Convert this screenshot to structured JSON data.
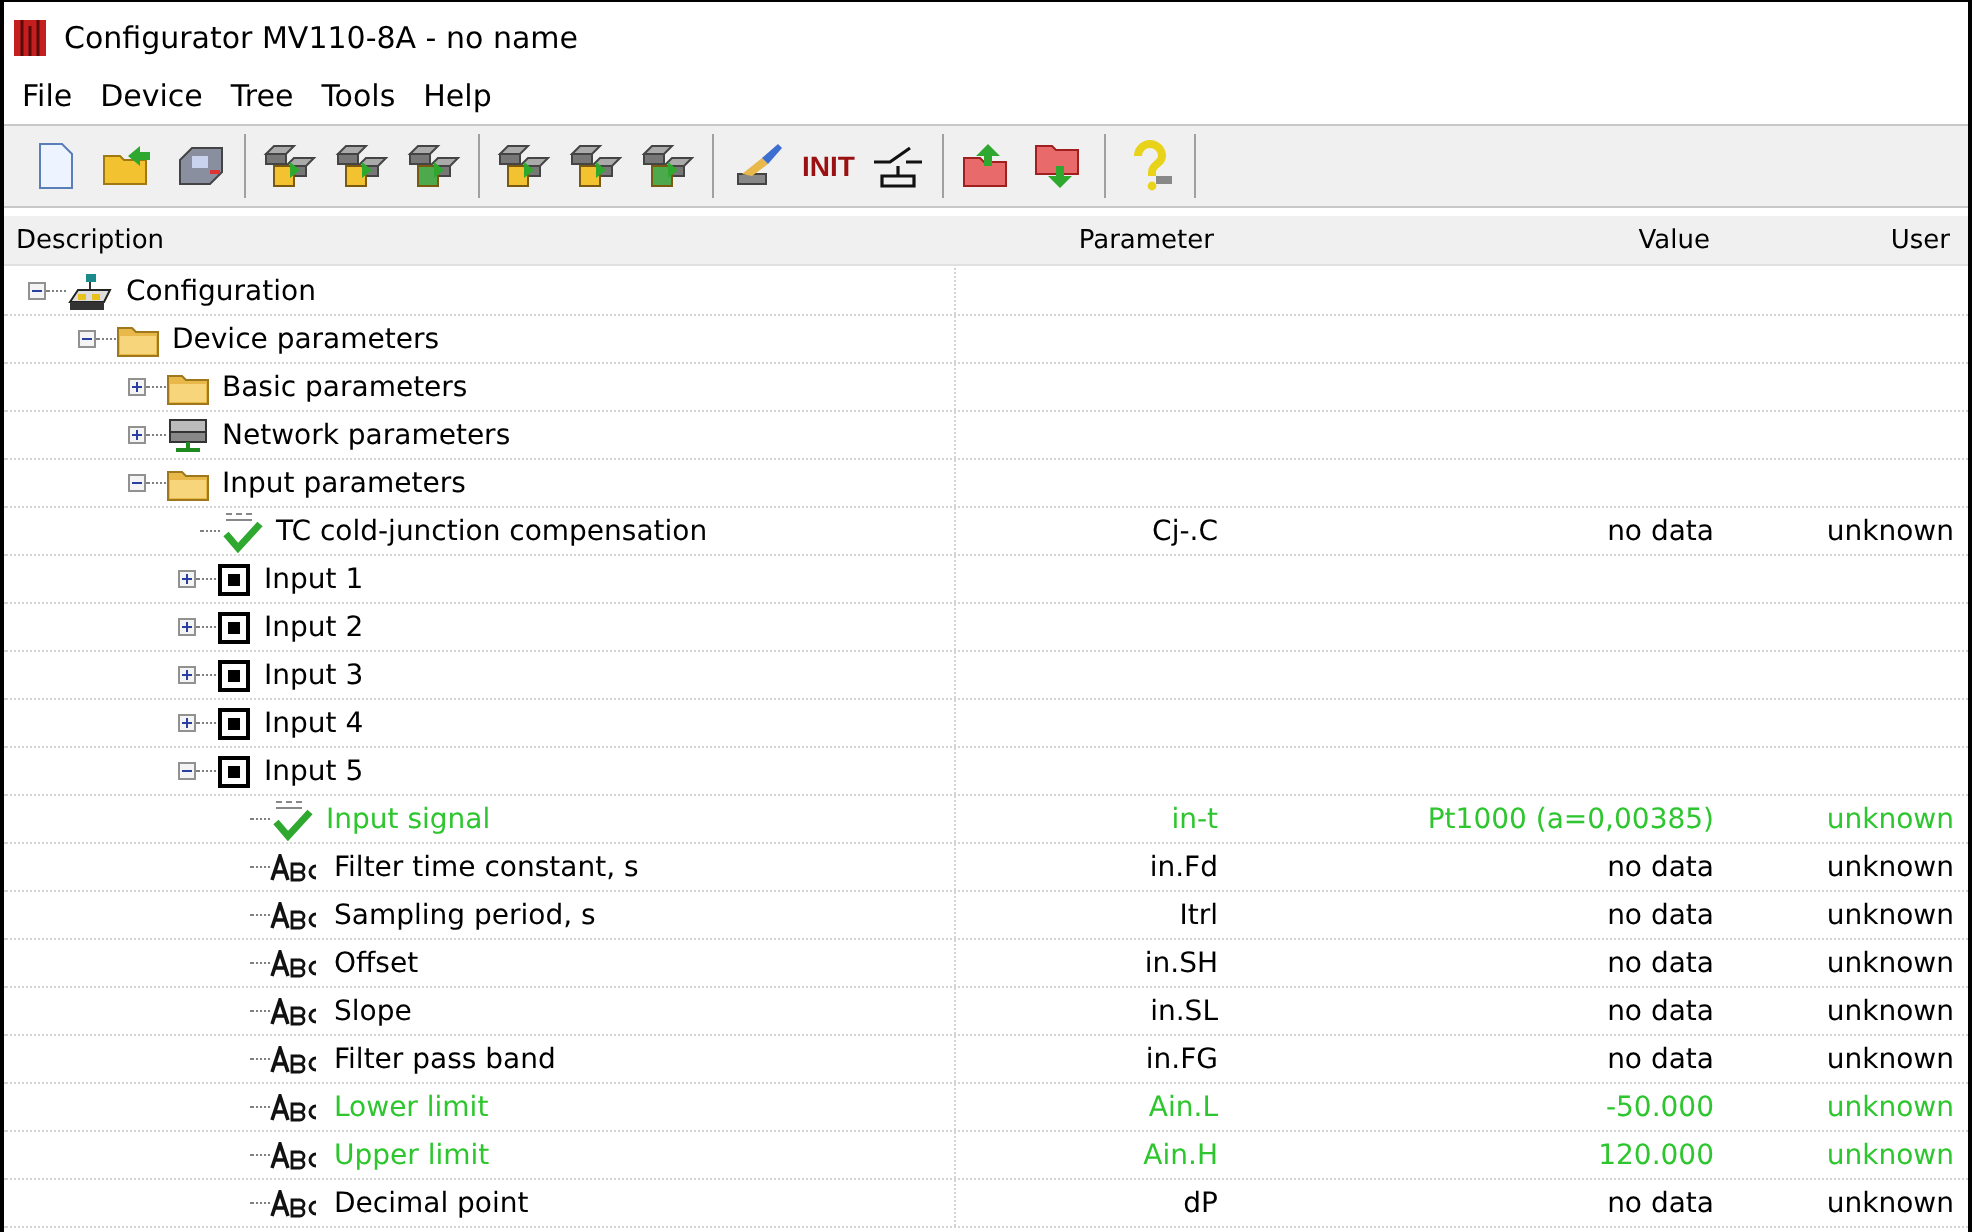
{
  "window": {
    "title": "Configurator MV110-8A - no name"
  },
  "menu": [
    {
      "label": "File"
    },
    {
      "label": "Device"
    },
    {
      "label": "Tree"
    },
    {
      "label": "Tools"
    },
    {
      "label": "Help"
    }
  ],
  "toolbar": [
    [
      {
        "kind": "icon"
      },
      {
        "kind": "icon"
      },
      {
        "kind": "icon"
      }
    ],
    [
      {
        "kind": "icon"
      },
      {
        "kind": "icon"
      },
      {
        "kind": "icon"
      }
    ],
    [
      {
        "kind": "icon"
      },
      {
        "kind": "icon"
      },
      {
        "kind": "icon"
      }
    ],
    [
      {
        "kind": "icon"
      },
      {
        "kind": "text",
        "label": "INIT"
      },
      {
        "kind": "icon"
      }
    ],
    [
      {
        "kind": "icon"
      },
      {
        "kind": "icon"
      }
    ],
    [
      {
        "kind": "icon"
      }
    ]
  ],
  "columns": [
    "Description",
    "Parameter",
    "Value",
    "User"
  ],
  "tree": [
    {
      "label": "Configuration",
      "kind": "config",
      "expanded": true,
      "children": [
        {
          "label": "Device parameters",
          "kind": "folder",
          "expanded": true,
          "children": [
            {
              "label": "Basic parameters",
              "kind": "folder",
              "expanded": false
            },
            {
              "label": "Network parameters",
              "kind": "network",
              "expanded": false
            },
            {
              "label": "Input parameters",
              "kind": "folder",
              "expanded": true,
              "children": [
                {
                  "label": "TC cold-junction compensation",
                  "kind": "list",
                  "parameter": "Cj-.C",
                  "value": "no data",
                  "user": "unknown",
                  "changed": false
                },
                {
                  "label": "Input 1",
                  "kind": "input",
                  "expanded": false
                },
                {
                  "label": "Input 2",
                  "kind": "input",
                  "expanded": false
                },
                {
                  "label": "Input 3",
                  "kind": "input",
                  "expanded": false
                },
                {
                  "label": "Input 4",
                  "kind": "input",
                  "expanded": false
                },
                {
                  "label": "Input 5",
                  "kind": "input",
                  "expanded": true,
                  "children": [
                    {
                      "label": "Input signal",
                      "kind": "list",
                      "parameter": "in-t",
                      "value": "Pt1000 (a=0,00385)",
                      "user": "unknown",
                      "changed": true
                    },
                    {
                      "label": "Filter time constant, s",
                      "kind": "text",
                      "parameter": "in.Fd",
                      "value": "no data",
                      "user": "unknown",
                      "changed": false
                    },
                    {
                      "label": "Sampling period, s",
                      "kind": "text",
                      "parameter": "Itrl",
                      "value": "no data",
                      "user": "unknown",
                      "changed": false
                    },
                    {
                      "label": "Offset",
                      "kind": "text",
                      "parameter": "in.SH",
                      "value": "no data",
                      "user": "unknown",
                      "changed": false
                    },
                    {
                      "label": "Slope",
                      "kind": "text",
                      "parameter": "in.SL",
                      "value": "no data",
                      "user": "unknown",
                      "changed": false
                    },
                    {
                      "label": "Filter pass band",
                      "kind": "text",
                      "parameter": "in.FG",
                      "value": "no data",
                      "user": "unknown",
                      "changed": false
                    },
                    {
                      "label": "Lower limit",
                      "kind": "text",
                      "parameter": "Ain.L",
                      "value": "-50.000",
                      "user": "unknown",
                      "changed": true
                    },
                    {
                      "label": "Upper limit",
                      "kind": "text",
                      "parameter": "Ain.H",
                      "value": "120.000",
                      "user": "unknown",
                      "changed": true
                    },
                    {
                      "label": "Decimal point",
                      "kind": "text",
                      "parameter": "dP",
                      "value": "no data",
                      "user": "unknown",
                      "changed": false
                    }
                  ]
                }
              ]
            }
          ]
        }
      ]
    }
  ]
}
